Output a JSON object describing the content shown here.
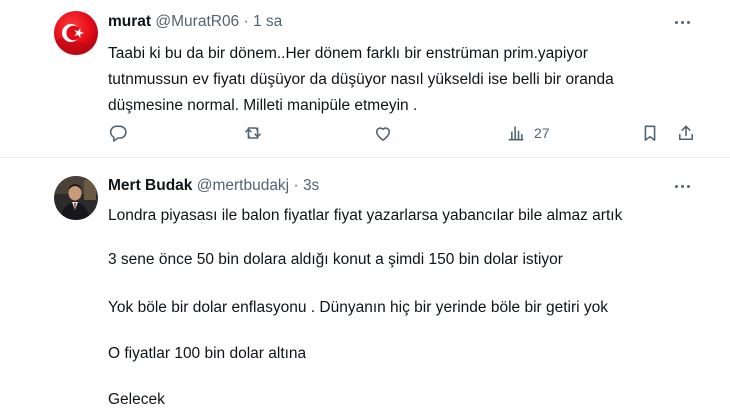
{
  "tweet1": {
    "name": "murat",
    "handle": "@MuratR06",
    "separator": "·",
    "time": "1 sa",
    "lines": [
      "Taabi ki bu da bir dönem..Her dönem farklı bir enstrüman prim.yapiyor",
      "tutnmussun ev fiyatı düşüyor da düşüyor nasıl yükseldi ise belli bir oranda",
      "düşmesine normal. Milleti manipüle etmeyin ."
    ],
    "views": "27",
    "actions": [
      "reply-icon",
      "retweet-icon",
      "like-icon",
      "views-icon",
      "bookmark-icon",
      "share-icon"
    ]
  },
  "tweet2": {
    "name": "Mert Budak",
    "handle": "@mertbudakj",
    "separator": "·",
    "time": "3s",
    "paragraphs": [
      "Londra piyasası ile balon fiyatlar fiyat yazarlarsa yabancılar bile almaz artık",
      "3 sene önce 50 bin dolara aldığı konut a şimdi 150 bin dolar istiyor",
      "Yok böle bir dolar enflasyonu . Dünyanın hiç bir yerinde böle bir getiri yok",
      "O fiyatlar 100 bin dolar altına",
      "Gelecek"
    ]
  },
  "colors": {
    "text": "#0f1419",
    "secondary": "#536471",
    "divider": "#eff3f4",
    "flag_red": "#e30a17"
  }
}
